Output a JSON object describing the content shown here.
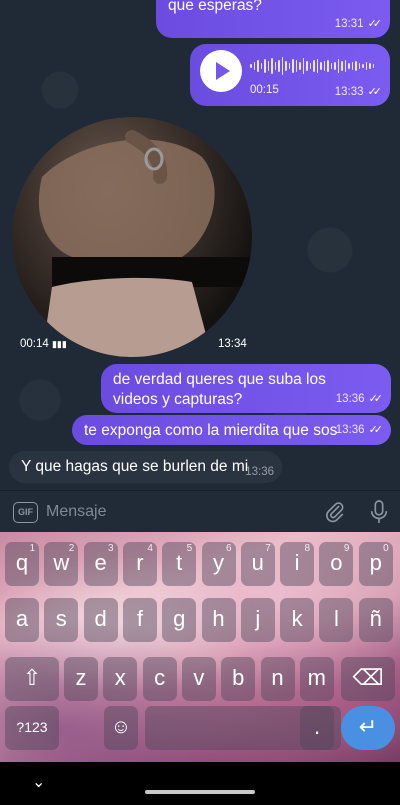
{
  "messages": {
    "m1": {
      "text": "que esperas?",
      "time": "13:31"
    },
    "voice": {
      "duration": "00:15",
      "time": "13:33"
    },
    "video": {
      "duration": "00:14",
      "time": "13:34"
    },
    "m3": {
      "text": "de verdad queres que suba los videos y capturas?",
      "time": "13:36"
    },
    "m4": {
      "text": "te exponga como la mierdita que sos",
      "time": "13:36"
    },
    "m5": {
      "text": "Y que hagas que se burlen de mi",
      "time": "13:36"
    },
    "read_ticks": "✓✓"
  },
  "input": {
    "placeholder": "Mensaje",
    "gif_label": "GIF"
  },
  "keyboard": {
    "row1": [
      {
        "k": "q",
        "h": "1"
      },
      {
        "k": "w",
        "h": "2"
      },
      {
        "k": "e",
        "h": "3"
      },
      {
        "k": "r",
        "h": "4"
      },
      {
        "k": "t",
        "h": "5"
      },
      {
        "k": "y",
        "h": "6"
      },
      {
        "k": "u",
        "h": "7"
      },
      {
        "k": "i",
        "h": "8"
      },
      {
        "k": "o",
        "h": "9"
      },
      {
        "k": "p",
        "h": "0"
      }
    ],
    "row2": [
      "a",
      "s",
      "d",
      "f",
      "g",
      "h",
      "j",
      "k",
      "l",
      "ñ"
    ],
    "row3": [
      "z",
      "x",
      "c",
      "v",
      "b",
      "n",
      "m"
    ],
    "sym_label": "?123",
    "period": ".",
    "emoji_label": "☺",
    "enter_label": "↵",
    "delete_label": "⌫",
    "shift_label": "⇧"
  },
  "nav": {
    "down_label": "⌄"
  }
}
